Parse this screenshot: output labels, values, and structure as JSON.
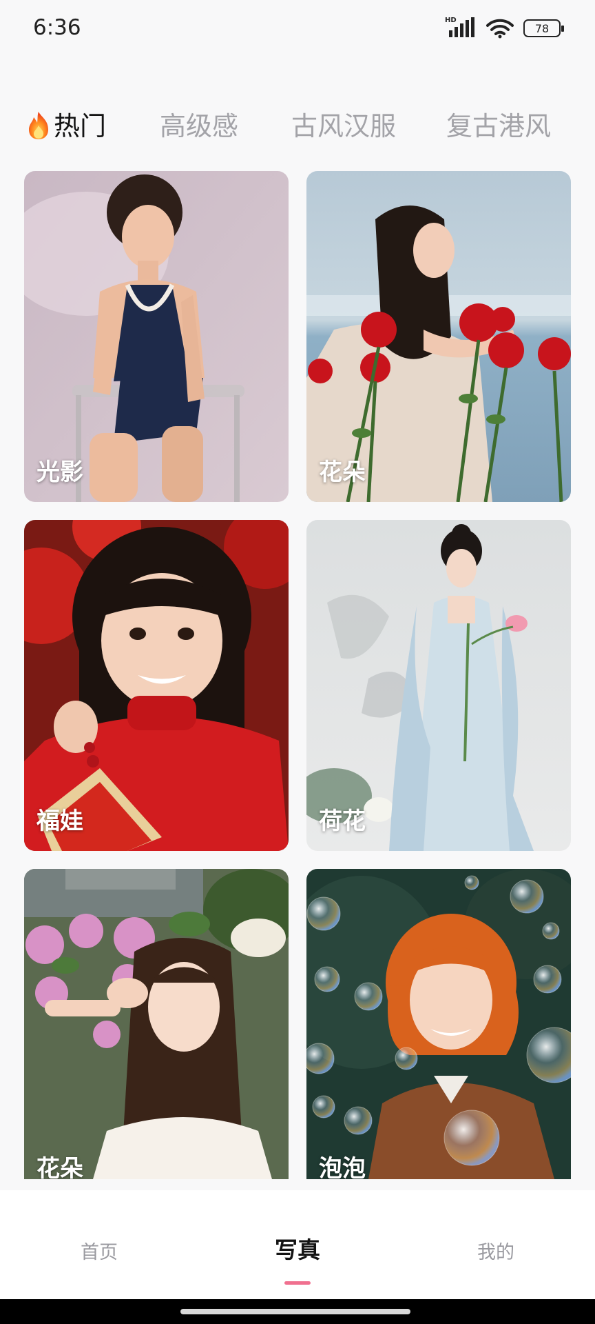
{
  "status_bar": {
    "time": "6:36",
    "network_label": "HD",
    "battery": "78"
  },
  "tabs": [
    {
      "label": "热门",
      "active": true,
      "icon": "flame-icon"
    },
    {
      "label": "高级感",
      "active": false
    },
    {
      "label": "古风汉服",
      "active": false
    },
    {
      "label": "复古港风",
      "active": false
    }
  ],
  "cards": [
    {
      "label": "光影",
      "photo": "woman-in-navy-swimsuit-on-chair"
    },
    {
      "label": "花朵",
      "photo": "woman-with-red-roses-by-sea"
    },
    {
      "label": "福娃",
      "photo": "girl-in-red-sweater-new-year"
    },
    {
      "label": "荷花",
      "photo": "woman-in-hanfu-holding-lotus"
    },
    {
      "label": "花朵",
      "photo": "woman-with-hydrangeas-peace-sign"
    },
    {
      "label": "泡泡",
      "photo": "woman-orange-hair-with-bubbles"
    }
  ],
  "bottom_nav": [
    {
      "label": "首页",
      "active": false
    },
    {
      "label": "写真",
      "active": true
    },
    {
      "label": "我的",
      "active": false
    }
  ],
  "colors": {
    "background": "#f8f8f9",
    "tab_active": "#141414",
    "tab_inactive": "#a3a3a8",
    "nav_indicator": "#f0708f",
    "card_label": "#ffffff"
  }
}
